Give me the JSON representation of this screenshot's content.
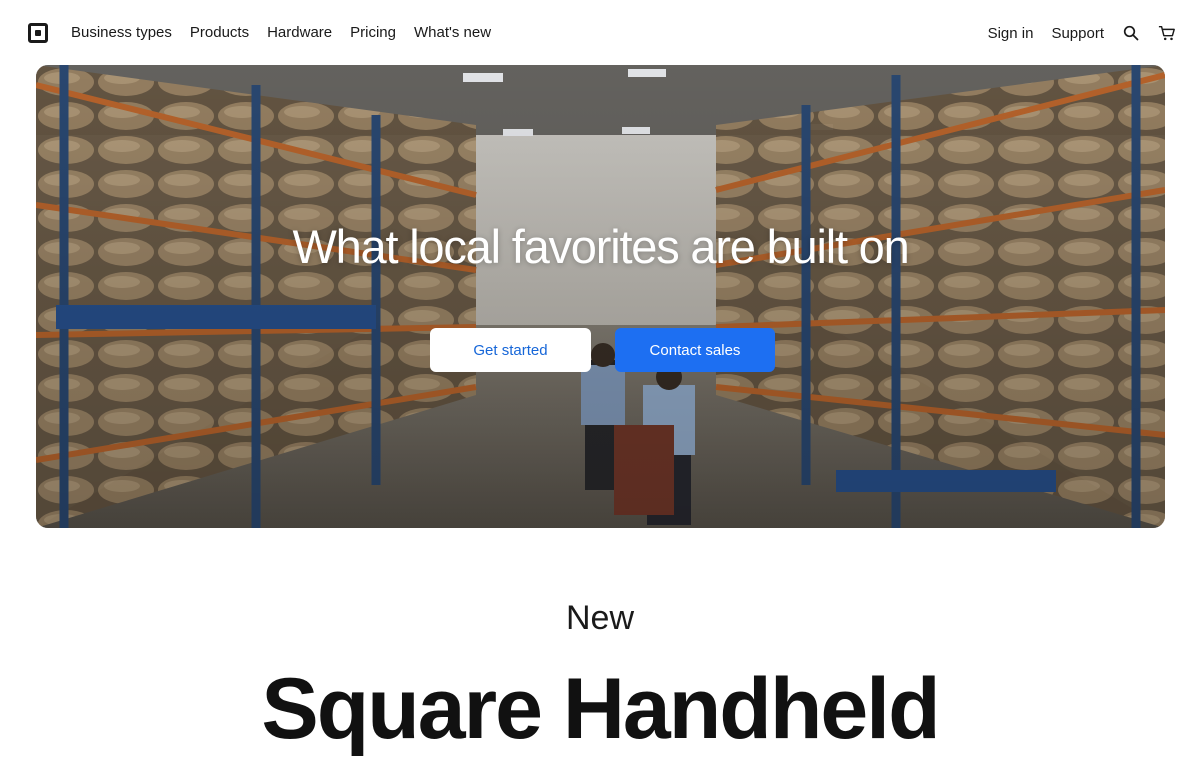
{
  "nav": {
    "left": [
      "Business types",
      "Products",
      "Hardware",
      "Pricing",
      "What's new"
    ],
    "sign_in": "Sign in",
    "support": "Support",
    "icons": {
      "search": "search-icon",
      "cart": "cart-icon",
      "logo": "square-logo"
    }
  },
  "hero": {
    "title": "What local favorites are built on",
    "primary_button": "Get started",
    "secondary_button": "Contact sales"
  },
  "section": {
    "eyebrow": "New",
    "heading": "Square Handheld"
  },
  "colors": {
    "accent_blue": "#1d6ff2",
    "link_blue": "#1666d8",
    "text": "#1a1a1a"
  }
}
